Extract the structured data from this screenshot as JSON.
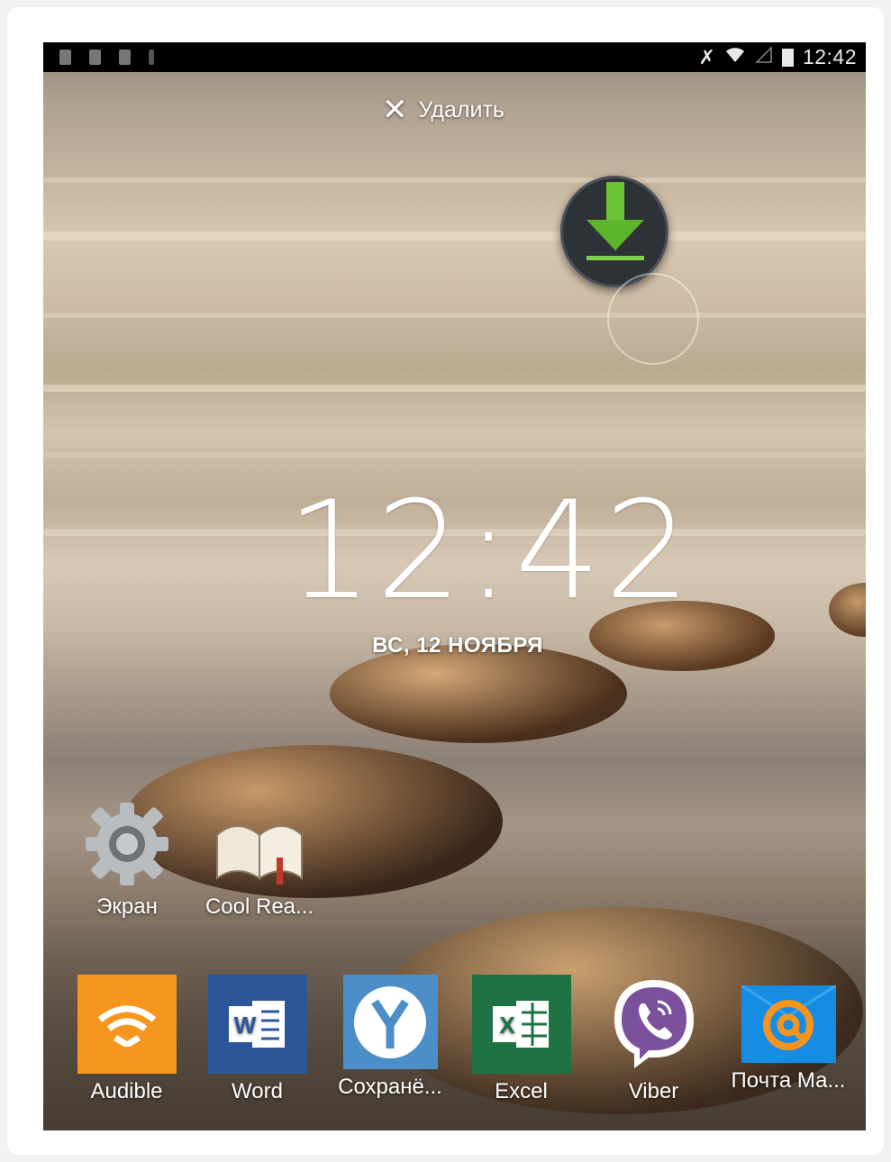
{
  "status_bar": {
    "time": "12:42",
    "icons": [
      "image-icon",
      "sd-card-icon",
      "document-icon",
      "download-icon",
      "mute-icon",
      "wifi-icon",
      "signal-icon",
      "battery-icon"
    ]
  },
  "edit_bar": {
    "delete_label": "Удалить"
  },
  "lock_clock": {
    "time": "12:42",
    "date": "ВС, 12 НОЯБРЯ"
  },
  "desktop_apps": [
    {
      "label": "Экран",
      "icon": "gear-icon"
    },
    {
      "label": "Cool Rea...",
      "icon": "book-icon"
    }
  ],
  "dock_apps": [
    {
      "label": "Audible",
      "icon": "audible-icon",
      "color": "#f7961d"
    },
    {
      "label": "Word",
      "icon": "word-icon",
      "color": "#2b579a"
    },
    {
      "label": "Сохранё...",
      "icon": "yandex-icon",
      "color": "#4b8ec8"
    },
    {
      "label": "Excel",
      "icon": "excel-icon",
      "color": "#1f7244"
    },
    {
      "label": "Viber",
      "icon": "viber-icon",
      "color": "#7b519d"
    },
    {
      "label": "Почта Ма...",
      "icon": "mail-icon",
      "color": "#168de2"
    }
  ]
}
